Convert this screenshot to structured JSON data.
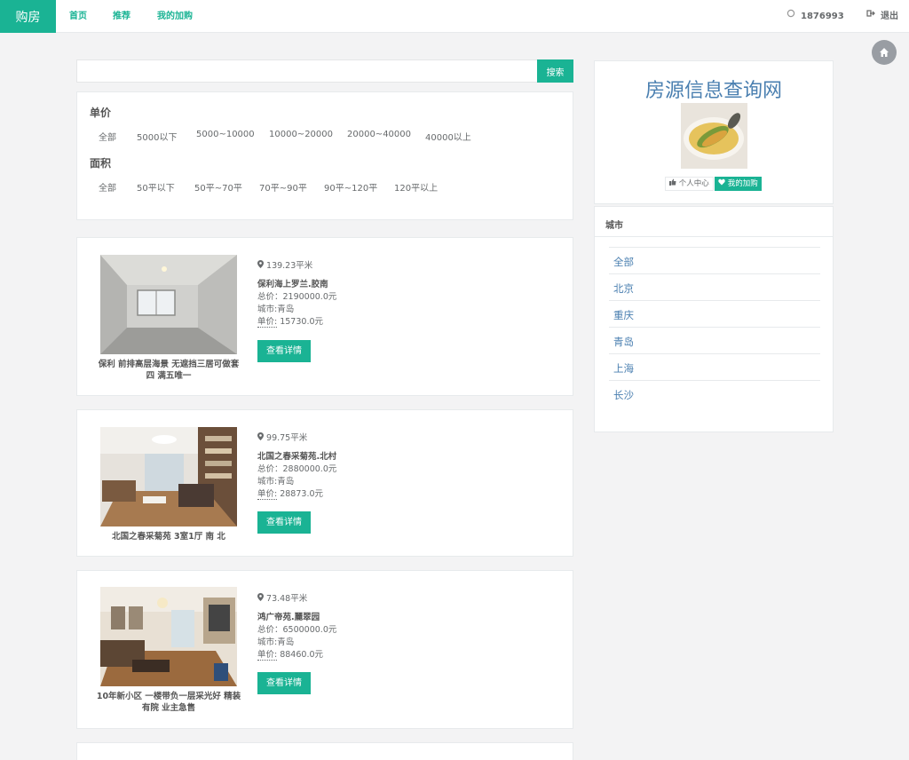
{
  "nav": {
    "brand": "购房",
    "links": [
      "首页",
      "推荐",
      "我的加购"
    ],
    "user_id": "1876993",
    "logout": "退出"
  },
  "search": {
    "placeholder": "",
    "button": "搜索"
  },
  "filters": {
    "price": {
      "title": "单价",
      "options": [
        "全部",
        "5000以下",
        "5000~10000",
        "10000~20000",
        "20000~40000",
        "40000以上"
      ]
    },
    "area": {
      "title": "面积",
      "options": [
        "全部",
        "50平以下",
        "50平~70平",
        "70平~90平",
        "90平~120平",
        "120平以上"
      ]
    }
  },
  "listings": [
    {
      "caption": "保利 前排高层海景 无遮挡三居可做套四 满五唯一",
      "area": "139.23平米",
      "name": "保利海上罗兰.胶南",
      "total": "总价：2190000.0元",
      "city": "城市:青岛",
      "unit_label": "单价:",
      "unit_value": " 15730.0元",
      "button": "查看详情"
    },
    {
      "caption": "北国之春采菊苑 3室1厅 南 北",
      "area": "99.75平米",
      "name": "北国之春采菊苑.北村",
      "total": "总价：2880000.0元",
      "city": "城市:青岛",
      "unit_label": "单价:",
      "unit_value": " 28873.0元",
      "button": "查看详情"
    },
    {
      "caption": "10年新小区 一楼带负一层采光好 精装有院 业主急售",
      "area": "73.48平米",
      "name": "鸿广帝苑.麗翠园",
      "total": "总价：6500000.0元",
      "city": "城市:青岛",
      "unit_label": "单价:",
      "unit_value": " 88460.0元",
      "button": "查看详情"
    }
  ],
  "profile": {
    "site_title": "房源信息查询网",
    "btn_profile": "个人中心",
    "btn_cart": "我的加购"
  },
  "cities": {
    "title": "城市",
    "items": [
      "全部",
      "北京",
      "重庆",
      "青岛",
      "上海",
      "长沙"
    ]
  },
  "colors": {
    "accent": "#1ab394",
    "link": "#4a7fb0"
  }
}
